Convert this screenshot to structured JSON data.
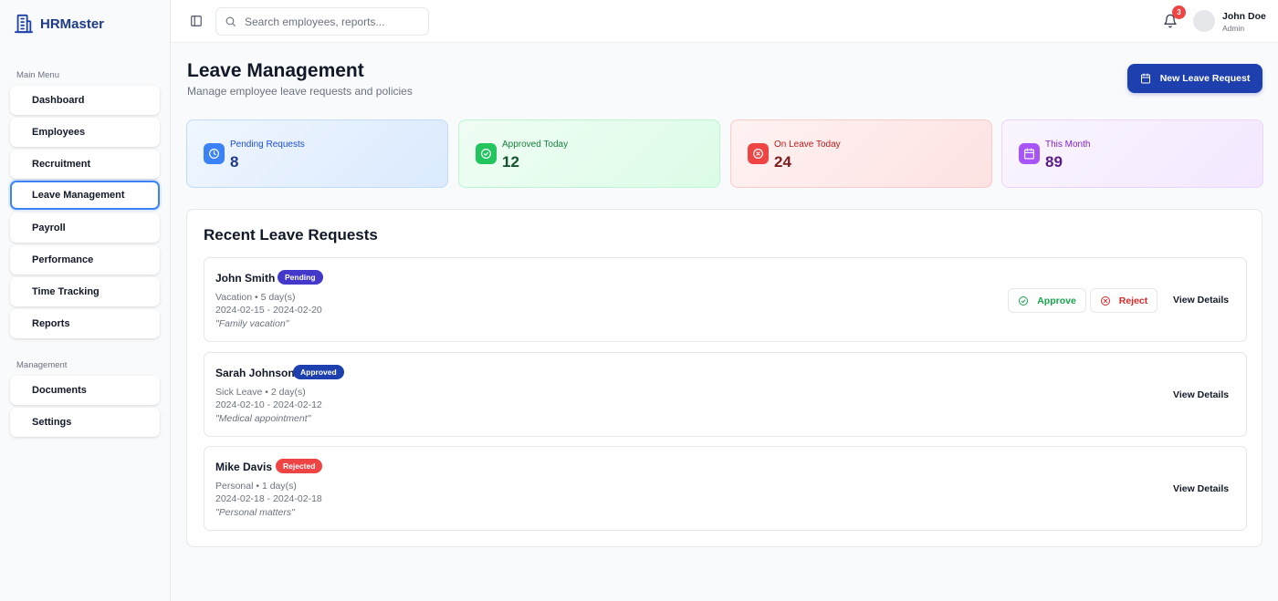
{
  "app": {
    "name": "HRMaster"
  },
  "sidebar": {
    "main_menu_label": "Main Menu",
    "main_items": [
      {
        "label": "Dashboard"
      },
      {
        "label": "Employees"
      },
      {
        "label": "Recruitment"
      },
      {
        "label": "Leave Management",
        "active": true
      },
      {
        "label": "Payroll"
      },
      {
        "label": "Performance"
      },
      {
        "label": "Time Tracking"
      },
      {
        "label": "Reports"
      }
    ],
    "management_label": "Management",
    "management_items": [
      {
        "label": "Documents"
      },
      {
        "label": "Settings"
      }
    ]
  },
  "topbar": {
    "search_placeholder": "Search employees, reports...",
    "notification_count": "3",
    "user_name": "John Doe",
    "user_role": "Admin"
  },
  "page": {
    "title": "Leave Management",
    "subtitle": "Manage employee leave requests and policies",
    "new_request_label": "New Leave Request"
  },
  "stats": [
    {
      "label": "Pending Requests",
      "value": "8",
      "icon": "clock-icon",
      "color": "#3b82f6"
    },
    {
      "label": "Approved Today",
      "value": "12",
      "icon": "check-circle-icon",
      "color": "#22c55e"
    },
    {
      "label": "On Leave Today",
      "value": "24",
      "icon": "x-circle-icon",
      "color": "#ef4444"
    },
    {
      "label": "This Month",
      "value": "89",
      "icon": "calendar-icon",
      "color": "#a855f7"
    }
  ],
  "requests": {
    "title": "Recent Leave Requests",
    "approve_label": "Approve",
    "reject_label": "Reject",
    "view_label": "View Details",
    "items": [
      {
        "name": "John Smith",
        "status": "Pending",
        "type_duration": "Vacation • 5 day(s)",
        "dates": "2024-02-15 - 2024-02-20",
        "reason": "\"Family vacation\""
      },
      {
        "name": "Sarah Johnson",
        "status": "Approved",
        "type_duration": "Sick Leave • 2 day(s)",
        "dates": "2024-02-10 - 2024-02-12",
        "reason": "\"Medical appointment\""
      },
      {
        "name": "Mike Davis",
        "status": "Rejected",
        "type_duration": "Personal • 1 day(s)",
        "dates": "2024-02-18 - 2024-02-18",
        "reason": "\"Personal matters\""
      }
    ]
  }
}
